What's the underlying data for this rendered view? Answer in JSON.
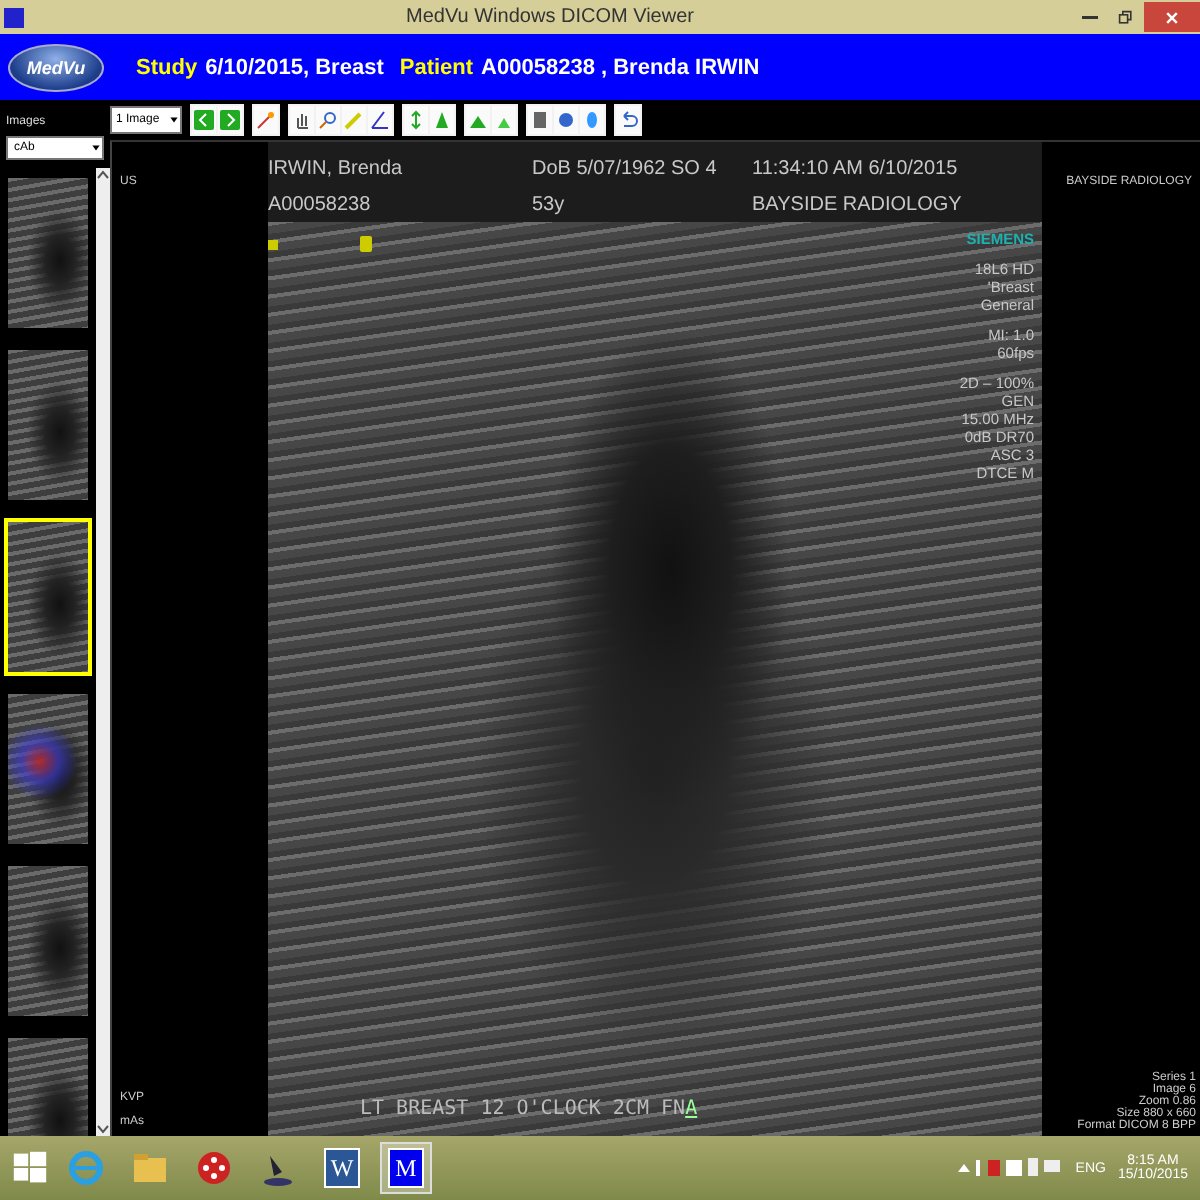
{
  "window": {
    "title": "MedVu Windows DICOM Viewer"
  },
  "header": {
    "logo": "MedVu",
    "study_label": "Study",
    "study": "6/10/2015, Breast",
    "patient_label": "Patient",
    "patient": "A00058238 , Brenda IRWIN"
  },
  "toolbar": {
    "layout": "1 Image"
  },
  "sidebar": {
    "label": "Images",
    "series": "cAb",
    "thumbnails": [
      {
        "kind": "grayscale",
        "selected": false
      },
      {
        "kind": "grayscale",
        "selected": false
      },
      {
        "kind": "grayscale",
        "selected": true
      },
      {
        "kind": "doppler",
        "selected": false
      },
      {
        "kind": "grayscale",
        "selected": false
      },
      {
        "kind": "grayscale",
        "selected": false
      }
    ]
  },
  "viewer": {
    "modality": "US",
    "patient_name": "IRWIN, Brenda",
    "dob": "DoB 5/07/1962  SO 4",
    "time": "11:34:10 AM 6/10/2015",
    "institution": "BAYSIDE RADIOLOGY",
    "patient_id": "A00058238",
    "age": "53y",
    "site": "BAYSIDE RADIOLOGY",
    "manufacturer": "SIEMENS",
    "parameter_groups": [
      [
        "18L6 HD",
        "'Breast",
        "General"
      ],
      [
        "MI: 1.0",
        "60fps"
      ],
      [
        "2D – 100%",
        "GEN",
        "15.00 MHz",
        "0dB DR70",
        "ASC 3",
        "DTCE M"
      ]
    ],
    "caption": "LT BREAST 12 O'CLOCK 2CM FN",
    "caption_marker": "A",
    "exposure": [
      "KVP",
      "mAs"
    ],
    "image_info": [
      "Series 1",
      "Image 6",
      "Zoom 0.86",
      "Size 880 x 660",
      "Format DICOM 8 BPP"
    ]
  },
  "taskbar": {
    "apps": [
      {
        "kind": "browser",
        "active": false
      },
      {
        "kind": "folder",
        "active": false
      },
      {
        "kind": "red",
        "active": false
      },
      {
        "kind": "dark",
        "active": false
      },
      {
        "kind": "word",
        "label": "W",
        "active": false
      },
      {
        "kind": "medvu",
        "label": "M",
        "active": true
      }
    ],
    "language": "ENG",
    "time": "8:15 AM",
    "date": "15/10/2015"
  }
}
